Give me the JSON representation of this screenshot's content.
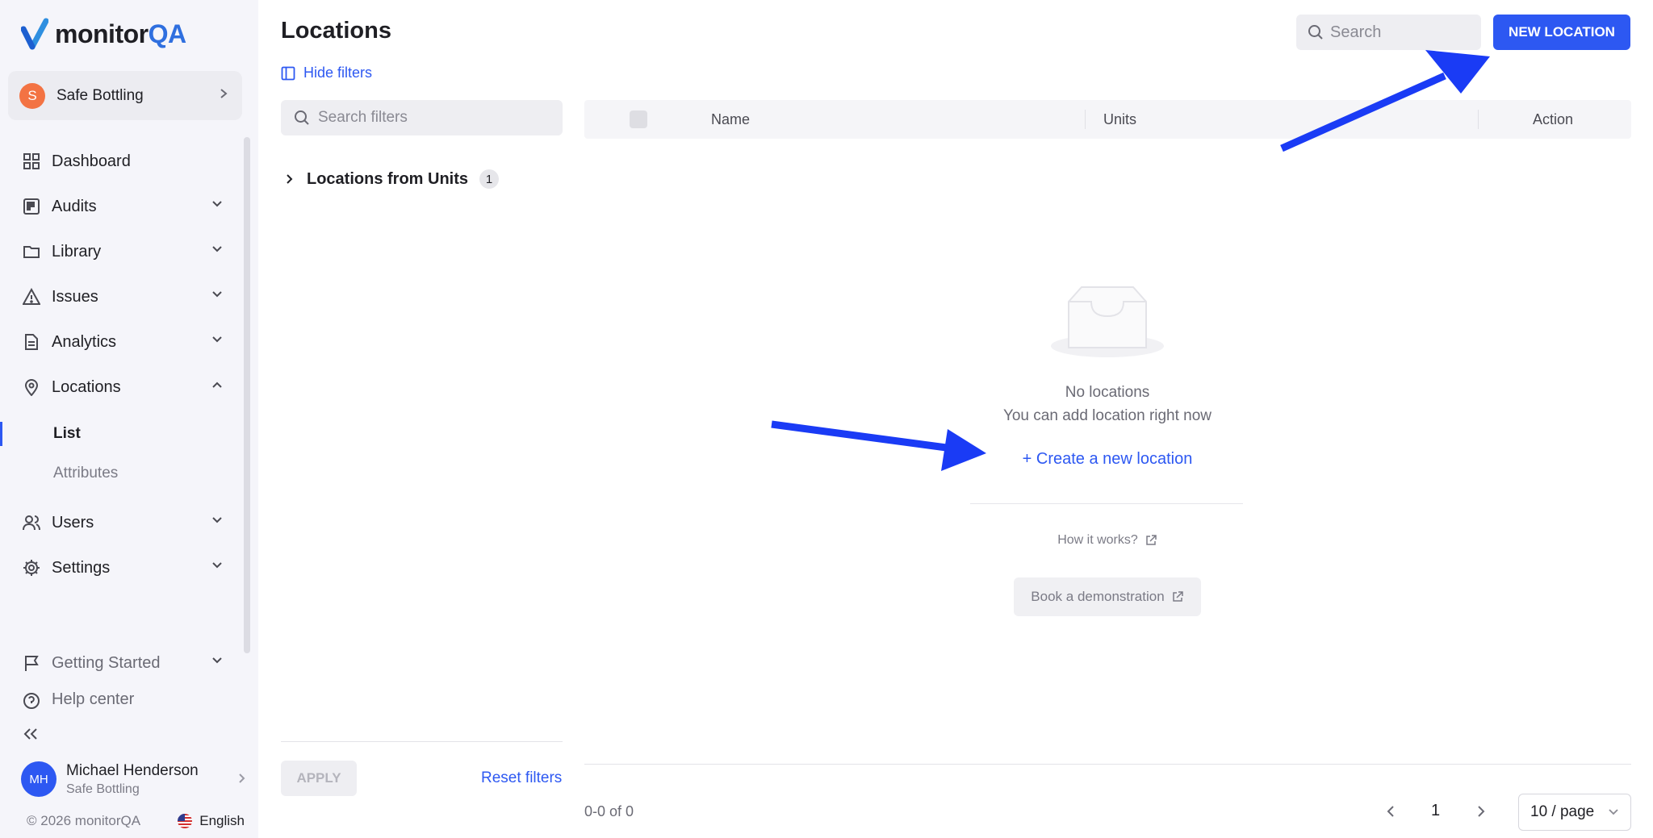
{
  "brand": {
    "name_main": "monitor",
    "name_accent": "QA",
    "accent_color": "#2d58f2"
  },
  "organization": {
    "initial": "S",
    "name": "Safe Bottling"
  },
  "sidebar": {
    "items": [
      {
        "label": "Dashboard",
        "icon": "dashboard-icon"
      },
      {
        "label": "Audits",
        "icon": "audits-icon"
      },
      {
        "label": "Library",
        "icon": "folder-icon"
      },
      {
        "label": "Issues",
        "icon": "warning-icon"
      },
      {
        "label": "Analytics",
        "icon": "document-icon"
      },
      {
        "label": "Locations",
        "icon": "map-pin-icon"
      },
      {
        "label": "Users",
        "icon": "users-icon"
      },
      {
        "label": "Settings",
        "icon": "gear-icon"
      },
      {
        "label": "Getting Started",
        "icon": "flag-icon"
      },
      {
        "label": "Help center",
        "icon": "help-icon"
      }
    ],
    "location_subitems": [
      {
        "label": "List",
        "active": true
      },
      {
        "label": "Attributes",
        "active": false
      }
    ]
  },
  "user": {
    "initials": "MH",
    "name": "Michael Henderson",
    "org": "Safe Bottling"
  },
  "footer": {
    "copyright": "© 2026 monitorQA",
    "language": "English"
  },
  "page": {
    "title": "Locations"
  },
  "search": {
    "placeholder": "Search"
  },
  "new_location_label": "NEW LOCATION",
  "filters": {
    "toggle_label": "Hide filters",
    "search_placeholder": "Search filters",
    "group_label": "Locations from Units",
    "group_count": "1",
    "apply_label": "APPLY",
    "reset_label": "Reset filters"
  },
  "table": {
    "columns": [
      "Name",
      "Units",
      "Action"
    ]
  },
  "empty_state": {
    "title": "No locations",
    "subtitle": "You can add location right now",
    "create_link": "+ Create a new location",
    "how_it_works": "How it works?",
    "book_demo": "Book a demonstration"
  },
  "pagination": {
    "range": "0-0 of 0",
    "current_page": "1",
    "page_size": "10 / page"
  }
}
